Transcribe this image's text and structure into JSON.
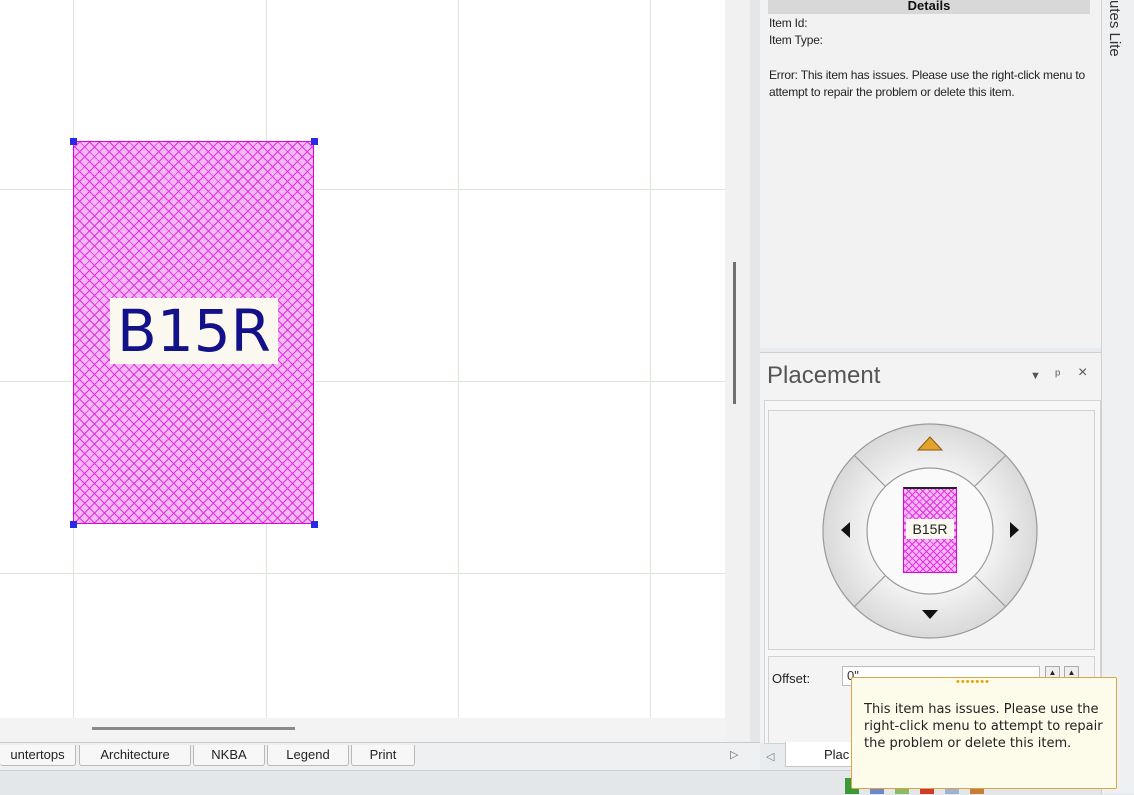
{
  "canvas": {
    "cabinet_label": "B15R",
    "cabinet_fill_color": "#e62ee6"
  },
  "bottom_tabs": [
    "untertops",
    "Architecture",
    "NKBA",
    "Legend",
    "Print"
  ],
  "details": {
    "header": "Details",
    "item_id_label": "Item Id:",
    "item_type_label": "Item Type:",
    "error_text": "Error: This item has issues. Please use the right-click menu to attempt to repair the problem or delete this item."
  },
  "side_panel_label": "utes Lite",
  "placement": {
    "title": "Placement",
    "thumbnail_label": "B15R",
    "offset_label": "Offset:",
    "offset_value": "0\""
  },
  "tooltip": {
    "text": "This item has issues. Please use the right-click menu to attempt to repair the problem or delete this item."
  },
  "right_tab_label": "Plac"
}
